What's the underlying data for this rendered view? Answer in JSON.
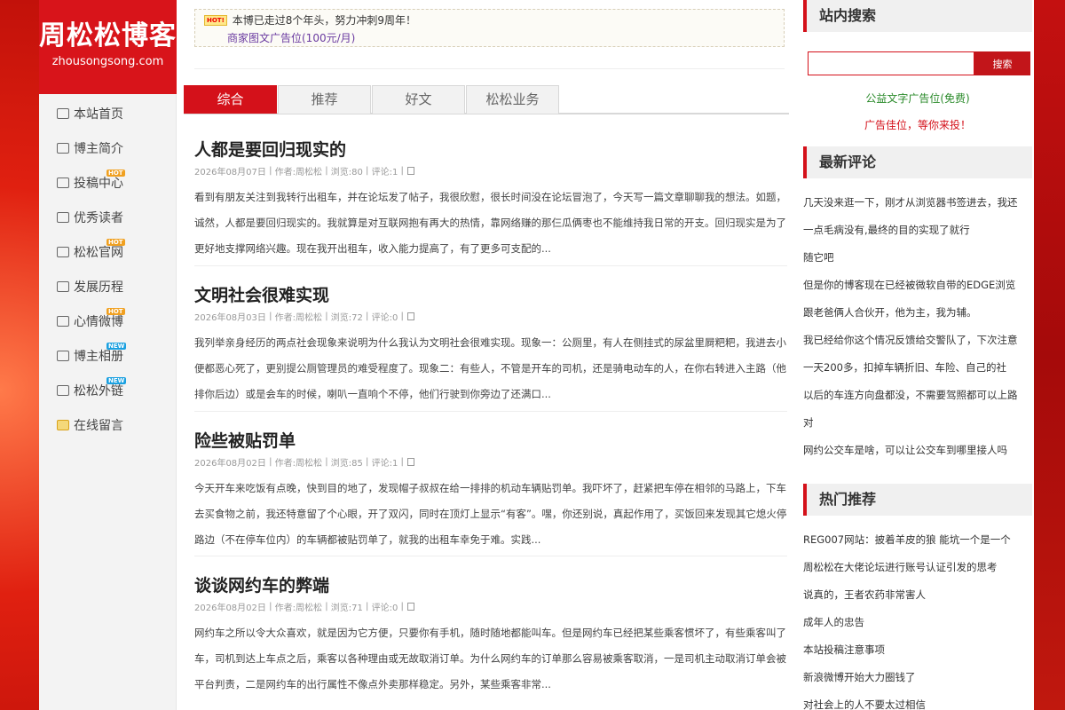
{
  "site": {
    "title": "周松松博客",
    "domain": "zhousongsong.com"
  },
  "nav": [
    {
      "label": "本站首页",
      "icon": "monitor-icon",
      "badge": ""
    },
    {
      "label": "博主简介",
      "icon": "monitor-icon",
      "badge": ""
    },
    {
      "label": "投稿中心",
      "icon": "book-icon",
      "badge": "HOT"
    },
    {
      "label": "优秀读者",
      "icon": "monitor-icon",
      "badge": ""
    },
    {
      "label": "松松官网",
      "icon": "monitor-icon",
      "badge": "HOT"
    },
    {
      "label": "发展历程",
      "icon": "monitor-icon",
      "badge": ""
    },
    {
      "label": "心情微博",
      "icon": "play-icon",
      "badge": "HOT"
    },
    {
      "label": "博主相册",
      "icon": "users-icon",
      "badge": "NEW"
    },
    {
      "label": "松松外链",
      "icon": "laptop-icon",
      "badge": "NEW"
    },
    {
      "label": "在线留言",
      "icon": "mail-icon",
      "badge": ""
    }
  ],
  "ad": {
    "hot": "HOT!",
    "line1": "本博已走过8个年头，努力冲刺9周年！",
    "line2": "商家图文广告位(100元/月)"
  },
  "tabs": [
    "综合",
    "推荐",
    "好文",
    "松松业务"
  ],
  "posts": [
    {
      "title": "人都是要回归现实的",
      "date": "2026年08月07日",
      "author": "作者:周松松",
      "views": "浏览:80",
      "comments": "评论:1",
      "excerpt": "看到有朋友关注到我转行出租车，并在论坛发了帖子，我很欣慰，很长时间没在论坛冒泡了，今天写一篇文章聊聊我的想法。如题，诚然，人都是要回归现实的。我就算是对互联网抱有再大的热情，靠网络赚的那仨瓜俩枣也不能维持我日常的开支。回归现实是为了更好地支撑网络兴趣。现在我开出租车，收入能力提高了，有了更多可支配的..."
    },
    {
      "title": "文明社会很难实现",
      "date": "2026年08月03日",
      "author": "作者:周松松",
      "views": "浏览:72",
      "comments": "评论:0",
      "excerpt": "我列举亲身经历的两点社会现象来说明为什么我认为文明社会很难实现。现象一：公厕里，有人在侧挂式的尿盆里屙粑粑，我进去小便都恶心死了，更别提公厕管理员的难受程度了。现象二：有些人，不管是开车的司机，还是骑电动车的人，在你右转进入主路（他排你后边）或是会车的时候，喇叭一直响个不停，他们行驶到你旁边了还满口..."
    },
    {
      "title": "险些被贴罚单",
      "date": "2026年08月02日",
      "author": "作者:周松松",
      "views": "浏览:85",
      "comments": "评论:1",
      "excerpt": "今天开车来吃饭有点晚，快到目的地了，发现帽子叔叔在给一排排的机动车辆贴罚单。我吓坏了，赶紧把车停在相邻的马路上，下车去买食物之前，我还特意留了个心眼，开了双闪，同时在顶灯上显示“有客”。嘿，你还别说，真起作用了，买饭回来发现其它熄火停路边（不在停车位内）的车辆都被贴罚单了，就我的出租车幸免于难。实践..."
    },
    {
      "title": "谈谈网约车的弊端",
      "date": "2026年08月02日",
      "author": "作者:周松松",
      "views": "浏览:71",
      "comments": "评论:0",
      "excerpt": "网约车之所以令大众喜欢，就是因为它方便，只要你有手机，随时随地都能叫车。但是网约车已经把某些乘客惯坏了，有些乘客叫了车，司机到达上车点之后，乘客以各种理由或无故取消订单。为什么网约车的订单那么容易被乘客取消，一是司机主动取消订单会被平台判责，二是网约车的出行属性不像点外卖那样稳定。另外，某些乘客非常..."
    }
  ],
  "right": {
    "search_title": "站内搜索",
    "search_button": "搜索",
    "search_placeholder": "",
    "ad1": "公益文字广告位(免费)",
    "ad2": "广告佳位，等你来投！",
    "comments_title": "最新评论",
    "comments": [
      "几天没来逛一下，刚才从浏览器书签进去，我还",
      "一点毛病没有,最终的目的实现了就行",
      "随它吧",
      "但是你的博客现在已经被微软自带的EDGE浏览",
      "跟老爸俩人合伙开，他为主，我为辅。",
      "我已经给你这个情况反馈给交警队了，下次注意",
      "一天200多，扣掉车辆折旧、车险、自己的社",
      "以后的车连方向盘都没，不需要驾照都可以上路",
      "对",
      "网约公交车是啥，可以让公交车到哪里接人吗"
    ],
    "hot_title": "热门推荐",
    "hot": [
      "REG007网站：披着羊皮的狼 能坑一个是一个",
      "周松松在大佬论坛进行账号认证引发的思考",
      "说真的，王者农药非常害人",
      "成年人的忠告",
      "本站投稿注意事项",
      "新浪微博开始大力圈钱了",
      "对社会上的人不要太过相信"
    ]
  },
  "colors": {
    "brand": "#d4111a",
    "link_purple": "#6a3aa0",
    "ad_green": "#2a8a2a",
    "ad_red": "#d4111a"
  }
}
